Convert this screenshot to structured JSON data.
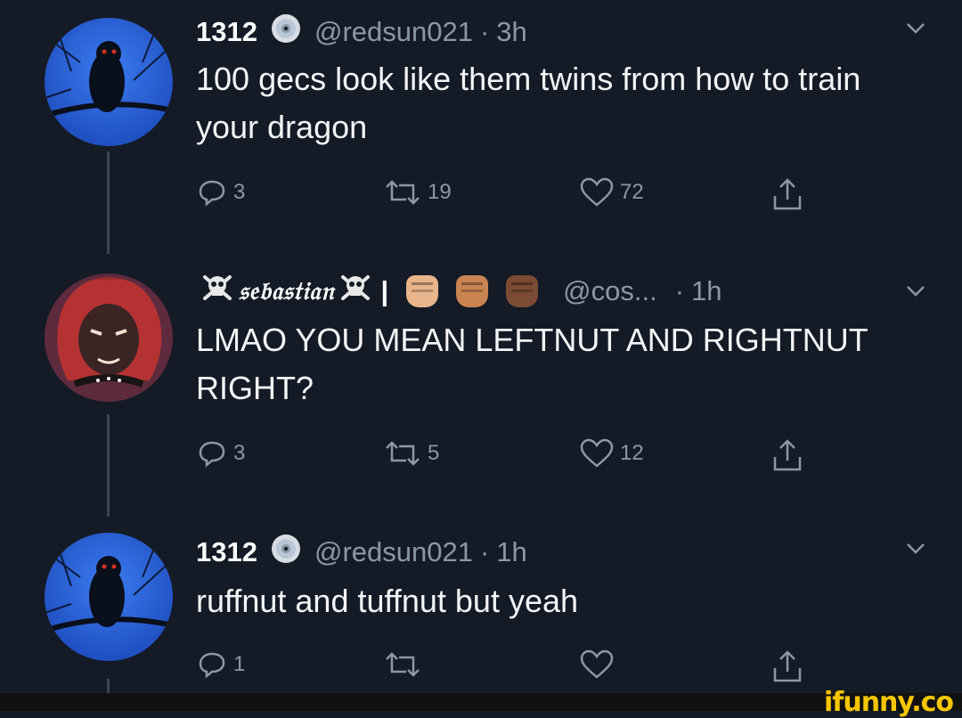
{
  "tweets": [
    {
      "display_name": "1312",
      "handle": "@redsun021",
      "separator": "·",
      "time": "3h",
      "text": "100 gecs look like them twins from how to train your dragon",
      "actions": {
        "replies": "3",
        "retweets": "19",
        "likes": "72"
      }
    },
    {
      "display_name": "𝔰𝔢𝔟𝔞𝔰𝔱𝔦𝔞𝔫",
      "separator_bar": "|",
      "handle": "@cos...",
      "separator": "·",
      "time": "1h",
      "text": "LMAO YOU MEAN LEFTNUT AND RIGHTNUT RIGHT?",
      "actions": {
        "replies": "3",
        "retweets": "5",
        "likes": "12"
      }
    },
    {
      "display_name": "1312",
      "handle": "@redsun021",
      "separator": "·",
      "time": "1h",
      "text": "ruffnut and tuffnut but yeah",
      "actions": {
        "replies": "1",
        "retweets": "",
        "likes": ""
      }
    }
  ],
  "icons": {
    "reply": "reply-icon",
    "retweet": "retweet-icon",
    "like": "heart-icon",
    "share": "share-icon",
    "caret": "chevron-down-icon",
    "verified": "cd-disc-icon"
  },
  "emoji_skin_tones": [
    "#e9b48a",
    "#c98452",
    "#7b4b33"
  ],
  "colors": {
    "background": "#141b26",
    "muted": "#8b98a5",
    "text": "#ffffff"
  },
  "watermark": "ifunny.co"
}
